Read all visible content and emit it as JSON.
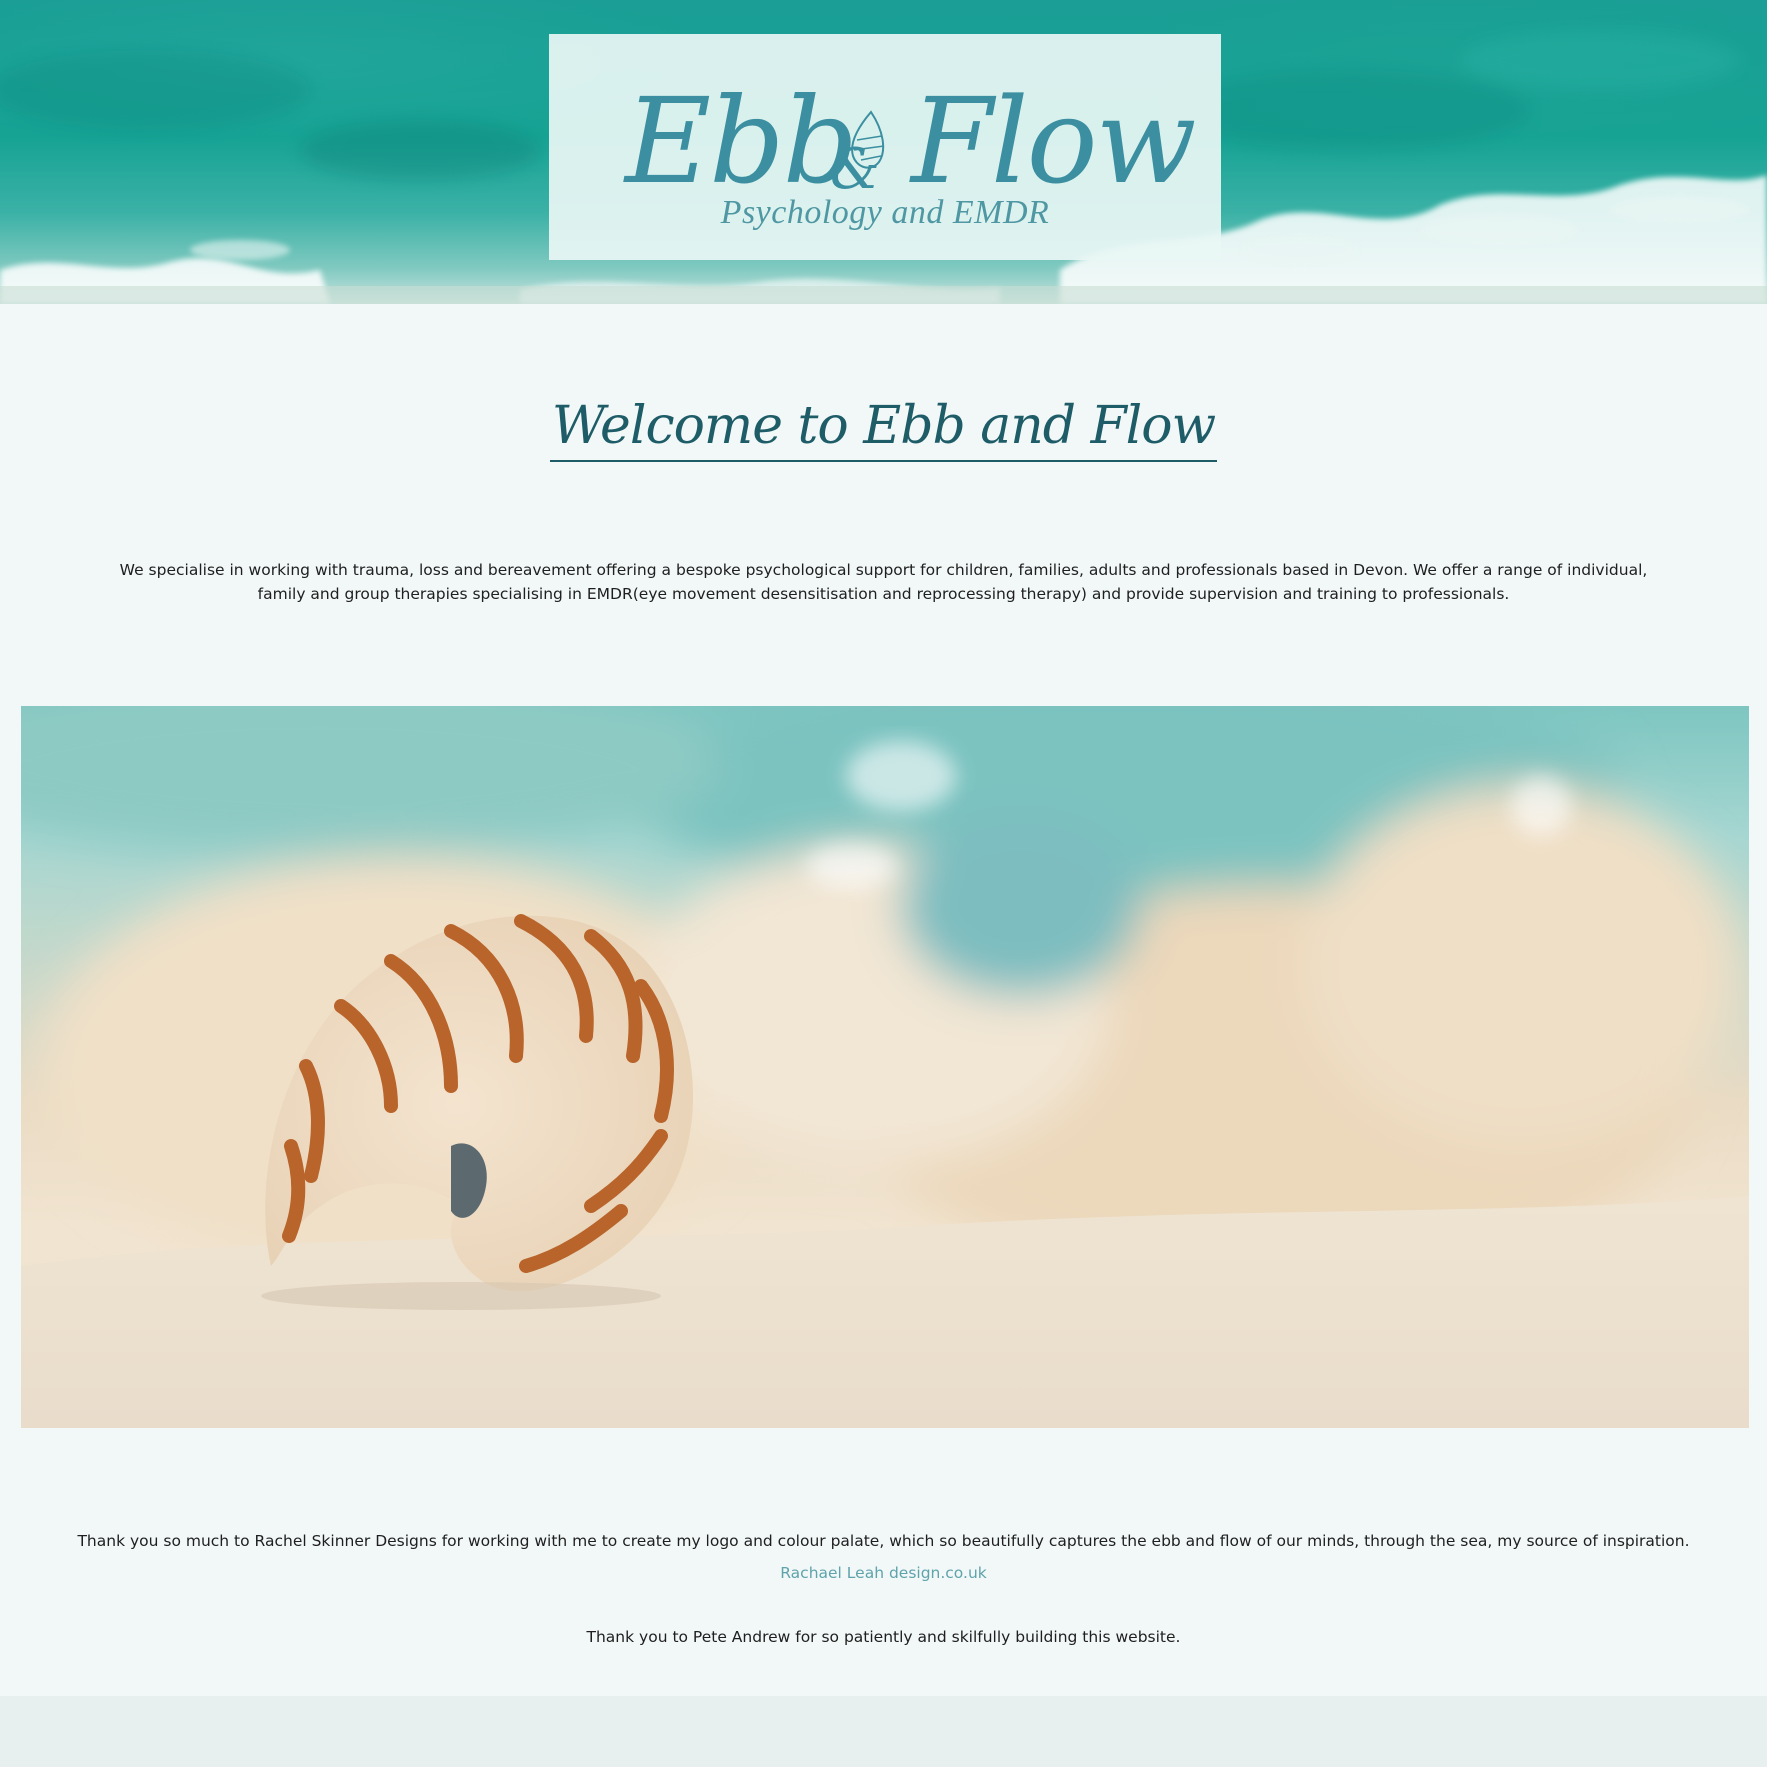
{
  "header": {
    "logo": {
      "word_left": "Ebb",
      "ampersand": "&",
      "word_right": "Flow",
      "tagline": "Psychology and EMDR"
    }
  },
  "welcome": {
    "title": "Welcome to Ebb and Flow"
  },
  "intro": {
    "text": "We specialise in working with trauma, loss and bereavement offering a bespoke psychological support for children, families, adults and professionals based in Devon. We offer a range of individual, family and group therapies specialising in EMDR(eye movement desensitisation and reprocessing therapy) and provide supervision and training to professionals."
  },
  "credits": {
    "designer_thanks": "Thank you so much to Rachel Skinner Designs for working with me to create my logo and colour palate, which so beautifully captures the ebb and flow of our minds, through the sea, my source of inspiration.",
    "designer_link": "Rachael Leah design.co.uk",
    "builder_thanks": "Thank you to Pete Andrew for so patiently and skilfully building this website."
  },
  "colors": {
    "page_background": "#f1f8f7",
    "heading": "#1e5c68",
    "logo_teal": "#3b8fa0",
    "link": "#5fa3ab",
    "sea": "#16a394"
  }
}
